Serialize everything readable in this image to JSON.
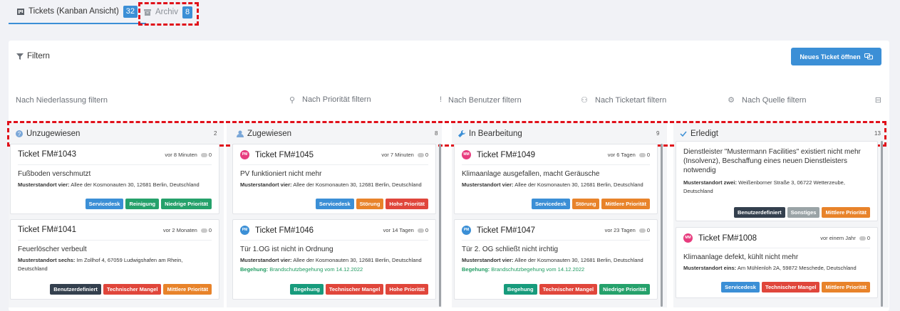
{
  "tabs": [
    {
      "label": "Tickets (Kanban Ansicht)",
      "count": "32",
      "icon": "kanban-icon"
    },
    {
      "label": "Archiv",
      "count": "8",
      "icon": "archive-icon"
    }
  ],
  "toolbar": {
    "filter_label": "Filtern",
    "new_ticket_label": "Neues Ticket öffnen"
  },
  "filters": [
    {
      "placeholder": "Nach Niederlassung filtern",
      "icon": "location-pin-icon",
      "glyph": "⚲"
    },
    {
      "placeholder": "Nach Priorität filtern",
      "icon": "exclamation-icon",
      "glyph": "!"
    },
    {
      "placeholder": "Nach Benutzer filtern",
      "icon": "user-icon",
      "glyph": "⚇"
    },
    {
      "placeholder": "Nach Ticketart filtern",
      "icon": "gear-icon",
      "glyph": "⚙"
    },
    {
      "placeholder": "Nach Quelle filtern",
      "icon": "source-icon",
      "glyph": "⊟"
    }
  ],
  "colors": {
    "blue": "#3b8fd6",
    "green": "#25a16b",
    "teal": "#179b7c",
    "orange": "#e8832a",
    "red": "#e0463b",
    "dark": "#34404e",
    "gray": "#9aa3a6",
    "highlight": "#e0101a"
  },
  "columns": [
    {
      "title": "Unzugewiesen",
      "count": "2",
      "icon": "question-icon",
      "cards": [
        {
          "title": "Ticket FM#1043",
          "time": "vor 8 Minuten",
          "comments": "0",
          "desc": "Fußboden verschmutzt",
          "site": "Musterstandort vier:",
          "address": "Allee der Kosmonauten 30, 12681 Berlin, Deutschland",
          "tags": [
            {
              "label": "Servicedesk",
              "color": "#3b8fd6"
            },
            {
              "label": "Reinigung",
              "color": "#25a16b"
            },
            {
              "label": "Niedrige Priorität",
              "color": "#25a16b"
            }
          ]
        },
        {
          "title": "Ticket FM#1041",
          "time": "vor 2 Monaten",
          "comments": "0",
          "desc": "Feuerlöscher verbeult",
          "site": "Musterstandort sechs:",
          "address": "Im Zollhof 4, 67059 Ludwigshafen am Rhein, Deutschland",
          "tags": [
            {
              "label": "Benutzerdefiniert",
              "color": "#34404e"
            },
            {
              "label": "Technischer Mangel",
              "color": "#e0463b"
            },
            {
              "label": "Mittlere Priorität",
              "color": "#e8832a"
            }
          ]
        }
      ]
    },
    {
      "title": "Zugewiesen",
      "count": "8",
      "icon": "user-icon",
      "cards": [
        {
          "title": "Ticket FM#1045",
          "avatar": "PM",
          "avatar_color": "#e73c7e",
          "time": "vor 7 Minuten",
          "comments": "0",
          "desc": "PV funktioniert nicht mehr",
          "site": "Musterstandort vier:",
          "address": "Allee der Kosmonauten 30, 12681 Berlin, Deutschland",
          "tags": [
            {
              "label": "Servicedesk",
              "color": "#3b8fd6"
            },
            {
              "label": "Störung",
              "color": "#e8832a"
            },
            {
              "label": "Hohe Priorität",
              "color": "#e0463b"
            }
          ]
        },
        {
          "title": "Ticket FM#1046",
          "avatar": "PM",
          "avatar_color": "#3b8fd6",
          "time": "vor 14 Tagen",
          "comments": "0",
          "desc": "Tür 1.OG ist nicht in Ordnung",
          "site": "Musterstandort vier:",
          "address": "Allee der Kosmonauten 30, 12681 Berlin, Deutschland",
          "begehung_label": "Begehung:",
          "begehung": "Brandschutzbegehung vom 14.12.2022",
          "tags": [
            {
              "label": "Begehung",
              "color": "#179b7c"
            },
            {
              "label": "Technischer Mangel",
              "color": "#e0463b"
            },
            {
              "label": "Hohe Priorität",
              "color": "#e0463b"
            }
          ]
        }
      ]
    },
    {
      "title": "In Bearbeitung",
      "count": "9",
      "icon": "wrench-icon",
      "cards": [
        {
          "title": "Ticket FM#1049",
          "avatar": "MM",
          "avatar_color": "#e73c7e",
          "time": "vor 6 Tagen",
          "comments": "0",
          "desc": "Klimaanlage ausgefallen, macht Geräusche",
          "site": "Musterstandort vier:",
          "address": "Allee der Kosmonauten 30, 12681 Berlin, Deutschland",
          "tags": [
            {
              "label": "Servicedesk",
              "color": "#3b8fd6"
            },
            {
              "label": "Störung",
              "color": "#e8832a"
            },
            {
              "label": "Mittlere Priorität",
              "color": "#e8832a"
            }
          ]
        },
        {
          "title": "Ticket FM#1047",
          "avatar": "PM",
          "avatar_color": "#3b8fd6",
          "time": "vor 23 Tagen",
          "comments": "0",
          "desc": "Tür 2. OG schließt nicht irchtig",
          "site": "Musterstandort vier:",
          "address": "Allee der Kosmonauten 30, 12681 Berlin, Deutschland",
          "begehung_label": "Begehung:",
          "begehung": "Brandschutzbegehung vom 14.12.2022",
          "tags": [
            {
              "label": "Begehung",
              "color": "#179b7c"
            },
            {
              "label": "Technischer Mangel",
              "color": "#e0463b"
            },
            {
              "label": "Niedrige Priorität",
              "color": "#25a16b"
            }
          ]
        }
      ]
    },
    {
      "title": "Erledigt",
      "count": "13",
      "icon": "check-icon",
      "cards": [
        {
          "desc": "Dienstleister \"Mustermann Facilities\" existiert nicht mehr (Insolvenz), Beschaffung eines neuen Dienstleisters notwendig",
          "site": "Musterstandort zwei:",
          "address": "Weißenborner Straße 3, 06722 Wetterzeube, Deutschland",
          "tags": [
            {
              "label": "Benutzerdefiniert",
              "color": "#34404e"
            },
            {
              "label": "Sonstiges",
              "color": "#9aa3a6"
            },
            {
              "label": "Mittlere Priorität",
              "color": "#e8832a"
            }
          ]
        },
        {
          "title": "Ticket FM#1008",
          "avatar": "MM",
          "avatar_color": "#e73c7e",
          "time": "vor einem Jahr",
          "comments": "0",
          "desc": "Klimaanlage defekt, kühlt nicht mehr",
          "site": "Musterstandort eins:",
          "address": "Am Mühlenloh 2A, 59872 Meschede, Deutschland",
          "tags": [
            {
              "label": "Servicedesk",
              "color": "#3b8fd6"
            },
            {
              "label": "Technischer Mangel",
              "color": "#e0463b"
            },
            {
              "label": "Mittlere Priorität",
              "color": "#e8832a"
            }
          ]
        }
      ]
    }
  ]
}
